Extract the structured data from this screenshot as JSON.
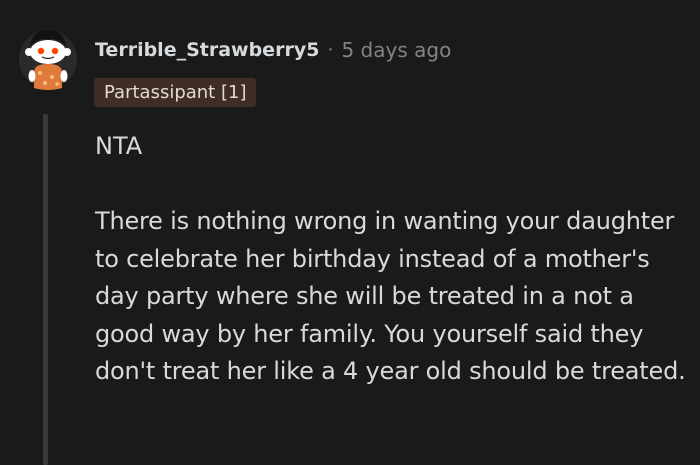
{
  "comment": {
    "author": "Terrible_Strawberry5",
    "separator": "·",
    "timestamp": "5 days ago",
    "flair": "Partassipant [1]",
    "body": {
      "verdict": "NTA",
      "paragraph": "There is nothing wrong in wanting your daughter to celebrate her birthday instead of a mother's day party where she will be treated in a not a good way by her family. You yourself said they don't treat her like a 4 year old should be treated."
    }
  },
  "colors": {
    "background": "#1a1a1b",
    "text": "#d7dadc",
    "meta": "#818384",
    "flair_bg": "#3f2e26",
    "thread_line": "#3a3a3c",
    "avatar_accent": "#ff4500"
  },
  "icons": {
    "avatar": "snoo-avatar-icon"
  }
}
